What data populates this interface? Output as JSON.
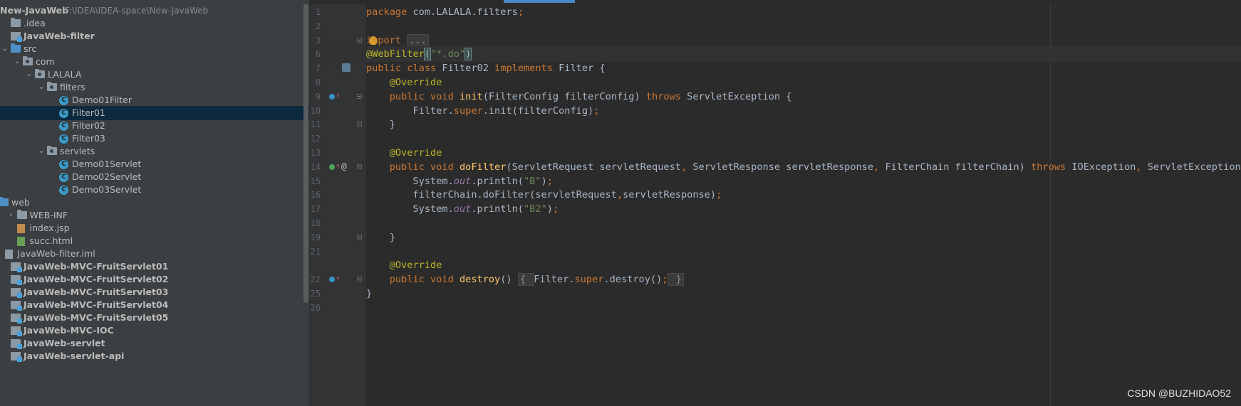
{
  "project_tree": {
    "root": {
      "name": "New-JavaWeb",
      "path": "F:\\IDEA\\IDEA-space\\New-JavaWeb"
    },
    "items": [
      {
        "label": ".idea",
        "icon": "folder-icon",
        "indent": 0,
        "arrow": ""
      },
      {
        "label": "JavaWeb-filter",
        "icon": "module-icon",
        "indent": 0,
        "arrow": "",
        "bold": true
      },
      {
        "label": "src",
        "icon": "source-folder-icon",
        "indent": 0,
        "arrow": "v"
      },
      {
        "label": "com",
        "icon": "package-icon",
        "indent": 1,
        "arrow": "v"
      },
      {
        "label": "LALALA",
        "icon": "package-icon",
        "indent": 2,
        "arrow": "v"
      },
      {
        "label": "filters",
        "icon": "package-icon",
        "indent": 3,
        "arrow": "v"
      },
      {
        "label": "Demo01Filter",
        "icon": "class-icon",
        "indent": 4,
        "arrow": ""
      },
      {
        "label": "Filter01",
        "icon": "class-icon",
        "indent": 4,
        "arrow": "",
        "selected": true
      },
      {
        "label": "Filter02",
        "icon": "class-icon",
        "indent": 4,
        "arrow": ""
      },
      {
        "label": "Filter03",
        "icon": "class-icon",
        "indent": 4,
        "arrow": ""
      },
      {
        "label": "servlets",
        "icon": "package-icon",
        "indent": 3,
        "arrow": "v"
      },
      {
        "label": "Demo01Servlet",
        "icon": "class-icon",
        "indent": 4,
        "arrow": ""
      },
      {
        "label": "Demo02Servlet",
        "icon": "class-icon",
        "indent": 4,
        "arrow": ""
      },
      {
        "label": "Demo03Servlet",
        "icon": "class-icon",
        "indent": 4,
        "arrow": ""
      },
      {
        "label": "web",
        "icon": "web-folder-icon",
        "indent": -1,
        "arrow": "v"
      },
      {
        "label": "WEB-INF",
        "icon": "folder-icon",
        "indent": 0.5,
        "arrow": ">"
      },
      {
        "label": "index.jsp",
        "icon": "jsp-file-icon",
        "indent": 0.5,
        "arrow": ""
      },
      {
        "label": "succ.html",
        "icon": "html-file-icon",
        "indent": 0.5,
        "arrow": ""
      },
      {
        "label": "JavaWeb-filter.iml",
        "icon": "iml-file-icon",
        "indent": -0.5,
        "arrow": ""
      },
      {
        "label": "JavaWeb-MVC-FruitServlet01",
        "icon": "module-icon",
        "indent": 0,
        "arrow": "",
        "bold": true
      },
      {
        "label": "JavaWeb-MVC-FruitServlet02",
        "icon": "module-icon",
        "indent": 0,
        "arrow": "",
        "bold": true
      },
      {
        "label": "JavaWeb-MVC-FruitServlet03",
        "icon": "module-icon",
        "indent": 0,
        "arrow": "",
        "bold": true
      },
      {
        "label": "JavaWeb-MVC-FruitServlet04",
        "icon": "module-icon",
        "indent": 0,
        "arrow": "",
        "bold": true
      },
      {
        "label": "JavaWeb-MVC-FruitServlet05",
        "icon": "module-icon",
        "indent": 0,
        "arrow": "",
        "bold": true
      },
      {
        "label": "JavaWeb-MVC-IOC",
        "icon": "module-icon",
        "indent": 0,
        "arrow": "",
        "bold": true
      },
      {
        "label": "JavaWeb-servlet",
        "icon": "module-icon",
        "indent": 0,
        "arrow": "",
        "bold": true
      },
      {
        "label": "JavaWeb-servlet-api",
        "icon": "module-icon",
        "indent": 0,
        "arrow": "",
        "bold": true
      }
    ]
  },
  "editor": {
    "lines": [
      {
        "num": "1",
        "tokens": [
          [
            "kw",
            "package "
          ],
          [
            "",
            "com.LALALA.filters"
          ],
          [
            "kw",
            ";"
          ]
        ]
      },
      {
        "num": "2",
        "tokens": []
      },
      {
        "num": "3",
        "tokens": [
          [
            "kw",
            "i"
          ],
          [
            "kw",
            "mport "
          ],
          [
            "fold",
            "..."
          ]
        ],
        "fold": true,
        "bulb": true
      },
      {
        "num": "6",
        "tokens": [
          [
            "ann",
            "@WebFilter"
          ],
          [
            "brace",
            "("
          ],
          [
            "str",
            "\"*.do\""
          ],
          [
            "brace",
            ")"
          ]
        ],
        "caret": true
      },
      {
        "num": "7",
        "tokens": [
          [
            "kw",
            "public class "
          ],
          [
            "",
            "Filter02 "
          ],
          [
            "kw",
            "implements "
          ],
          [
            "",
            "Filter {"
          ]
        ],
        "web": true
      },
      {
        "num": "8",
        "tokens": [
          [
            "ann",
            "    @Override"
          ]
        ]
      },
      {
        "num": "9",
        "tokens": [
          [
            "kw",
            "    public void "
          ],
          [
            "fn",
            "init"
          ],
          [
            "",
            "(FilterConfig filterConfig) "
          ],
          [
            "kw",
            "throws "
          ],
          [
            "",
            "ServletException {"
          ]
        ],
        "ovr": "blue",
        "fold": true
      },
      {
        "num": "10",
        "tokens": [
          [
            "",
            "        Filter."
          ],
          [
            "kw",
            "super"
          ],
          [
            "",
            ".init(filterConfig)"
          ],
          [
            "kw",
            ";"
          ]
        ]
      },
      {
        "num": "11",
        "tokens": [
          [
            "",
            "    }"
          ]
        ],
        "fold": true
      },
      {
        "num": "12",
        "tokens": []
      },
      {
        "num": "13",
        "tokens": [
          [
            "ann",
            "    @Override"
          ]
        ]
      },
      {
        "num": "14",
        "tokens": [
          [
            "kw",
            "    public void "
          ],
          [
            "fn",
            "doFilter"
          ],
          [
            "",
            "(ServletRequest servletRequest"
          ],
          [
            "kw",
            ", "
          ],
          [
            "",
            "ServletResponse servletResponse"
          ],
          [
            "kw",
            ", "
          ],
          [
            "",
            "FilterChain filterChain) "
          ],
          [
            "kw",
            "throws "
          ],
          [
            "",
            "IOException"
          ],
          [
            "kw",
            ", "
          ],
          [
            "",
            "ServletException {"
          ]
        ],
        "ovr": "green",
        "at": true,
        "fold": true
      },
      {
        "num": "15",
        "tokens": [
          [
            "",
            "        System."
          ],
          [
            "st",
            "out"
          ],
          [
            "",
            ".println("
          ],
          [
            "str",
            "\"B\""
          ],
          [
            "",
            ")"
          ],
          [
            "kw",
            ";"
          ]
        ]
      },
      {
        "num": "16",
        "tokens": [
          [
            "",
            "        filterChain.doFilter(servletRequest"
          ],
          [
            "kw",
            ","
          ],
          [
            "",
            "servletResponse)"
          ],
          [
            "kw",
            ";"
          ]
        ]
      },
      {
        "num": "17",
        "tokens": [
          [
            "",
            "        System."
          ],
          [
            "st",
            "out"
          ],
          [
            "",
            ".println("
          ],
          [
            "str",
            "\"B2\""
          ],
          [
            "",
            ")"
          ],
          [
            "kw",
            ";"
          ]
        ]
      },
      {
        "num": "18",
        "tokens": []
      },
      {
        "num": "19",
        "tokens": [
          [
            "",
            "    }"
          ]
        ],
        "fold": true
      },
      {
        "num": "21",
        "tokens": []
      },
      {
        "num": "21b",
        "tokens": [
          [
            "ann",
            "    @Override"
          ]
        ],
        "hide_num": true
      },
      {
        "num": "22",
        "tokens": [
          [
            "kw",
            "    public void "
          ],
          [
            "fn",
            "destroy"
          ],
          [
            "",
            "() "
          ],
          [
            "fold",
            "{ "
          ],
          [
            "",
            "Filter."
          ],
          [
            "kw",
            "super"
          ],
          [
            "",
            ".destroy()"
          ],
          [
            "kw",
            ";"
          ],
          [
            "fold",
            " }"
          ]
        ],
        "ovr": "blue",
        "fold": true
      },
      {
        "num": "25",
        "tokens": [
          [
            "",
            "}"
          ]
        ]
      },
      {
        "num": "26",
        "tokens": []
      }
    ]
  },
  "watermark": "CSDN @BUZHIDAO52"
}
